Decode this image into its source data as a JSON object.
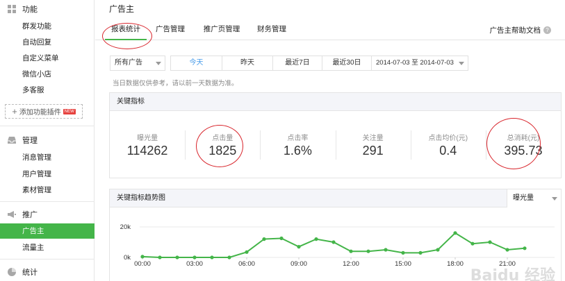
{
  "sidebar": {
    "sections": [
      {
        "key": "func",
        "label": "功能",
        "icon": "grid-icon",
        "items": [
          "群发功能",
          "自动回复",
          "自定义菜单",
          "微信小店",
          "多客服"
        ]
      },
      {
        "key": "manage",
        "label": "管理",
        "icon": "inbox-icon",
        "items": [
          "消息管理",
          "用户管理",
          "素材管理"
        ]
      },
      {
        "key": "promo",
        "label": "推广",
        "icon": "megaphone-icon",
        "items": [
          "广告主",
          "流量主"
        ]
      },
      {
        "key": "stats",
        "label": "统计",
        "icon": "pie-icon",
        "items": []
      }
    ],
    "add_plugin_label": "添加功能插件",
    "new_badge": "NEW",
    "active_item": "广告主"
  },
  "header": {
    "title": "广告主",
    "tabs": [
      "报表统计",
      "广告管理",
      "推广页管理",
      "财务管理"
    ],
    "active_tab": "报表统计",
    "help_label": "广告主帮助文档"
  },
  "filters": {
    "ad_select": "所有广告",
    "ranges": [
      "今天",
      "昨天",
      "最近7日",
      "最近30日"
    ],
    "active_range": "今天",
    "date_range": "2014-07-03 至 2014-07-03",
    "note": "当日数据仅供参考，请以前一天数据为准。"
  },
  "kpi_panel": {
    "title": "关键指标",
    "items": [
      {
        "label": "曝光量",
        "value": "114262"
      },
      {
        "label": "点击量",
        "value": "1825"
      },
      {
        "label": "点击率",
        "value": "1.6%"
      },
      {
        "label": "关注量",
        "value": "291"
      },
      {
        "label": "点击均价(元)",
        "value": "0.4"
      },
      {
        "label": "总消耗(元)",
        "value": "395.73"
      }
    ]
  },
  "trend_panel": {
    "title": "关键指标趋势图",
    "metric_select": "曝光量"
  },
  "chart_data": {
    "type": "line",
    "title": "",
    "x": [
      "00:00",
      "01:00",
      "02:00",
      "03:00",
      "04:00",
      "05:00",
      "06:00",
      "07:00",
      "08:00",
      "09:00",
      "10:00",
      "11:00",
      "12:00",
      "13:00",
      "14:00",
      "15:00",
      "16:00",
      "17:00",
      "18:00",
      "19:00",
      "20:00",
      "21:00",
      "22:00"
    ],
    "y": [
      500,
      0,
      0,
      0,
      0,
      0,
      3500,
      12000,
      12500,
      7000,
      12000,
      10000,
      4000,
      4000,
      5000,
      3000,
      3000,
      5000,
      16000,
      9000,
      10000,
      5000,
      6000
    ],
    "xticks": [
      "00:00",
      "03:00",
      "06:00",
      "09:00",
      "12:00",
      "15:00",
      "18:00",
      "21:00"
    ],
    "yticks": [
      "0k",
      "20k"
    ],
    "ylim": [
      0,
      20000
    ],
    "color": "#44b549",
    "grid": true
  },
  "watermark": "Baidu 经验"
}
